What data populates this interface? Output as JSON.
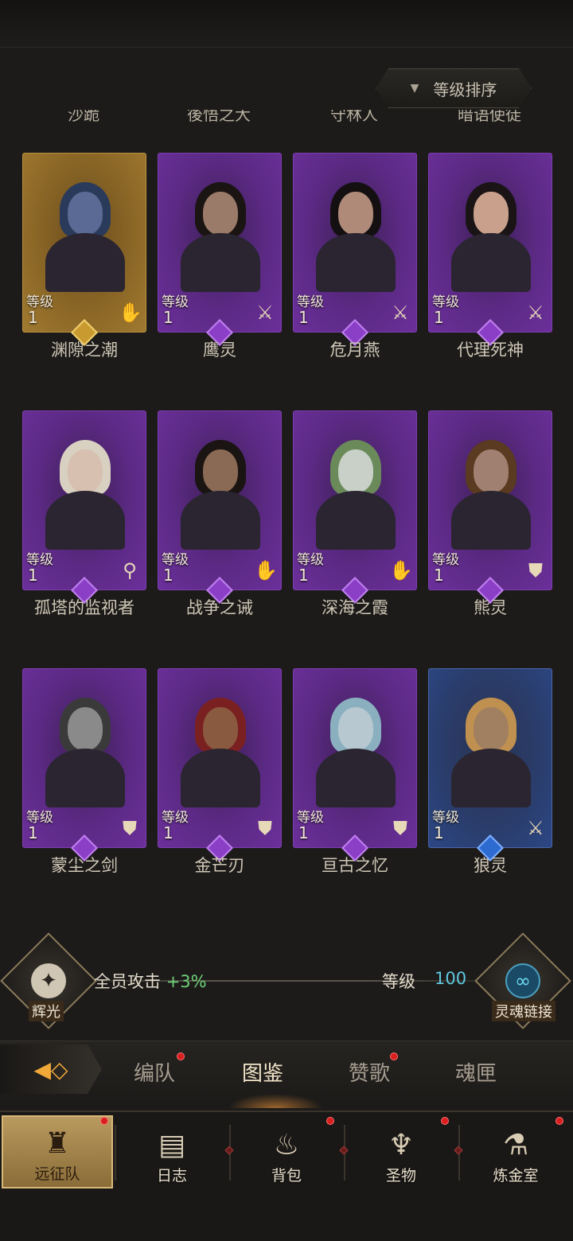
{
  "sort_button": {
    "label": "等级排序",
    "arrow": "▼"
  },
  "cut_off_names": [
    "沙跪",
    "後悟之大",
    "守林人",
    "暗语使徒"
  ],
  "level_label": "等级",
  "heroes": [
    {
      "name": "渊隙之潮",
      "level": "1",
      "rarity": "gold",
      "class_icon": "hand-icon"
    },
    {
      "name": "鹰灵",
      "level": "1",
      "rarity": "purple",
      "class_icon": "sword-icon"
    },
    {
      "name": "危月燕",
      "level": "1",
      "rarity": "purple",
      "class_icon": "sword-icon"
    },
    {
      "name": "代理死神",
      "level": "1",
      "rarity": "purple",
      "class_icon": "sword-icon"
    },
    {
      "name": "孤塔的监视者",
      "level": "1",
      "rarity": "purple",
      "class_icon": "staff-icon"
    },
    {
      "name": "战争之诫",
      "level": "1",
      "rarity": "purple",
      "class_icon": "hand-icon"
    },
    {
      "name": "深海之霞",
      "level": "1",
      "rarity": "purple",
      "class_icon": "hand-icon"
    },
    {
      "name": "熊灵",
      "level": "1",
      "rarity": "purple",
      "class_icon": "shield-icon"
    },
    {
      "name": "蒙尘之剑",
      "level": "1",
      "rarity": "purple",
      "class_icon": "shield-icon"
    },
    {
      "name": "金芒刃",
      "level": "1",
      "rarity": "purple",
      "class_icon": "shield-icon"
    },
    {
      "name": "亘古之忆",
      "level": "1",
      "rarity": "purple",
      "class_icon": "shield-icon"
    },
    {
      "name": "狼灵",
      "level": "1",
      "rarity": "blue",
      "class_icon": "sword-icon"
    }
  ],
  "bonus": {
    "emblem_label": "辉光",
    "text": "全员攻击",
    "value": "+3%",
    "level_label": "等级",
    "level_value": "100",
    "link_label": "灵魂链接"
  },
  "tabs": [
    {
      "label": "编队",
      "badge": true
    },
    {
      "label": "图鉴",
      "badge": false,
      "active": true
    },
    {
      "label": "赞歌",
      "badge": true
    },
    {
      "label": "魂匣",
      "badge": false
    }
  ],
  "nav": [
    {
      "label": "远征队",
      "icon": "viking-helmet-icon",
      "badge": true,
      "active": true
    },
    {
      "label": "日志",
      "icon": "scroll-icon",
      "badge": false
    },
    {
      "label": "背包",
      "icon": "backpack-icon",
      "badge": true
    },
    {
      "label": "圣物",
      "icon": "chalice-icon",
      "badge": true
    },
    {
      "label": "炼金室",
      "icon": "alchemy-icon",
      "badge": false
    }
  ],
  "colors": {
    "purple_frame": "#6b2f9a",
    "gold_frame": "#a07a30",
    "blue_frame": "#2c4785",
    "bonus_green": "#6fd27a",
    "level_cyan": "#5fc8e0",
    "badge_red": "#d81e1e"
  }
}
